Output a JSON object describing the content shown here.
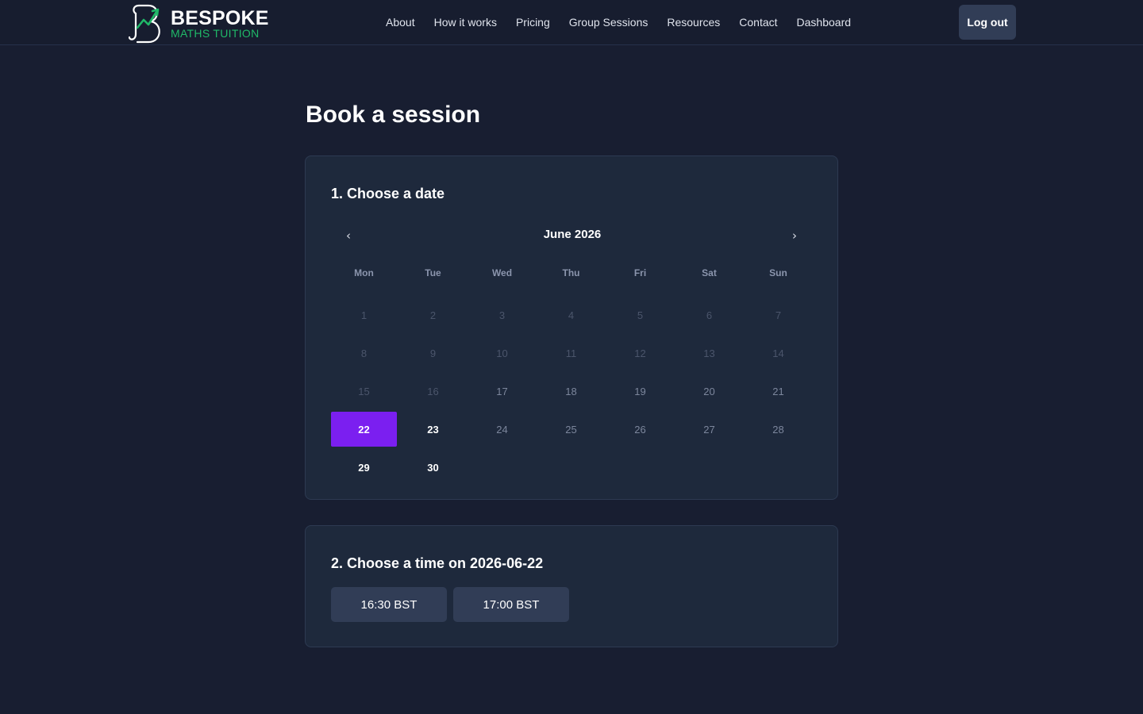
{
  "brand": {
    "name_line1": "BESPOKE",
    "name_line2": "MATHS TUITION",
    "accent_color": "#20b868",
    "icon": "logo-mark-icon"
  },
  "nav": {
    "items": [
      "About",
      "How it works",
      "Pricing",
      "Group Sessions",
      "Resources",
      "Contact",
      "Dashboard"
    ],
    "logout_label": "Log out"
  },
  "page": {
    "title": "Book a session"
  },
  "date_step": {
    "title": "1. Choose a date",
    "month_label": "June 2026",
    "prev_icon": "chevron-left-icon",
    "next_icon": "chevron-right-icon",
    "prev_glyph": "‹",
    "next_glyph": "›",
    "weekdays": [
      "Mon",
      "Tue",
      "Wed",
      "Thu",
      "Fri",
      "Sat",
      "Sun"
    ],
    "days": [
      {
        "label": "1",
        "state": "disabled"
      },
      {
        "label": "2",
        "state": "disabled"
      },
      {
        "label": "3",
        "state": "disabled"
      },
      {
        "label": "4",
        "state": "disabled"
      },
      {
        "label": "5",
        "state": "disabled"
      },
      {
        "label": "6",
        "state": "disabled"
      },
      {
        "label": "7",
        "state": "disabled"
      },
      {
        "label": "8",
        "state": "disabled"
      },
      {
        "label": "9",
        "state": "disabled"
      },
      {
        "label": "10",
        "state": "disabled"
      },
      {
        "label": "11",
        "state": "disabled"
      },
      {
        "label": "12",
        "state": "disabled"
      },
      {
        "label": "13",
        "state": "disabled"
      },
      {
        "label": "14",
        "state": "disabled"
      },
      {
        "label": "15",
        "state": "disabled"
      },
      {
        "label": "16",
        "state": "disabled"
      },
      {
        "label": "17",
        "state": "unavailable"
      },
      {
        "label": "18",
        "state": "unavailable"
      },
      {
        "label": "19",
        "state": "unavailable"
      },
      {
        "label": "20",
        "state": "unavailable"
      },
      {
        "label": "21",
        "state": "unavailable"
      },
      {
        "label": "22",
        "state": "selected"
      },
      {
        "label": "23",
        "state": "available"
      },
      {
        "label": "24",
        "state": "unavailable"
      },
      {
        "label": "25",
        "state": "unavailable"
      },
      {
        "label": "26",
        "state": "unavailable"
      },
      {
        "label": "27",
        "state": "unavailable"
      },
      {
        "label": "28",
        "state": "unavailable"
      },
      {
        "label": "29",
        "state": "available"
      },
      {
        "label": "30",
        "state": "available"
      }
    ],
    "selected_color": "#7b1ff0"
  },
  "time_step": {
    "title": "2. Choose a time on 2026-06-22",
    "slots": [
      "16:30 BST",
      "17:00 BST"
    ]
  }
}
